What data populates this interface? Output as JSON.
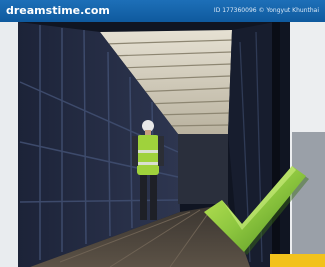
{
  "banner": {
    "logo_text": "dreamstime.com",
    "credit": "ID 177360096 © Yongyut Khunthai"
  },
  "image": {
    "description_icon": "checkmark-icon",
    "accent_color": "#8dc63f",
    "banner_color": "#1565a8"
  }
}
